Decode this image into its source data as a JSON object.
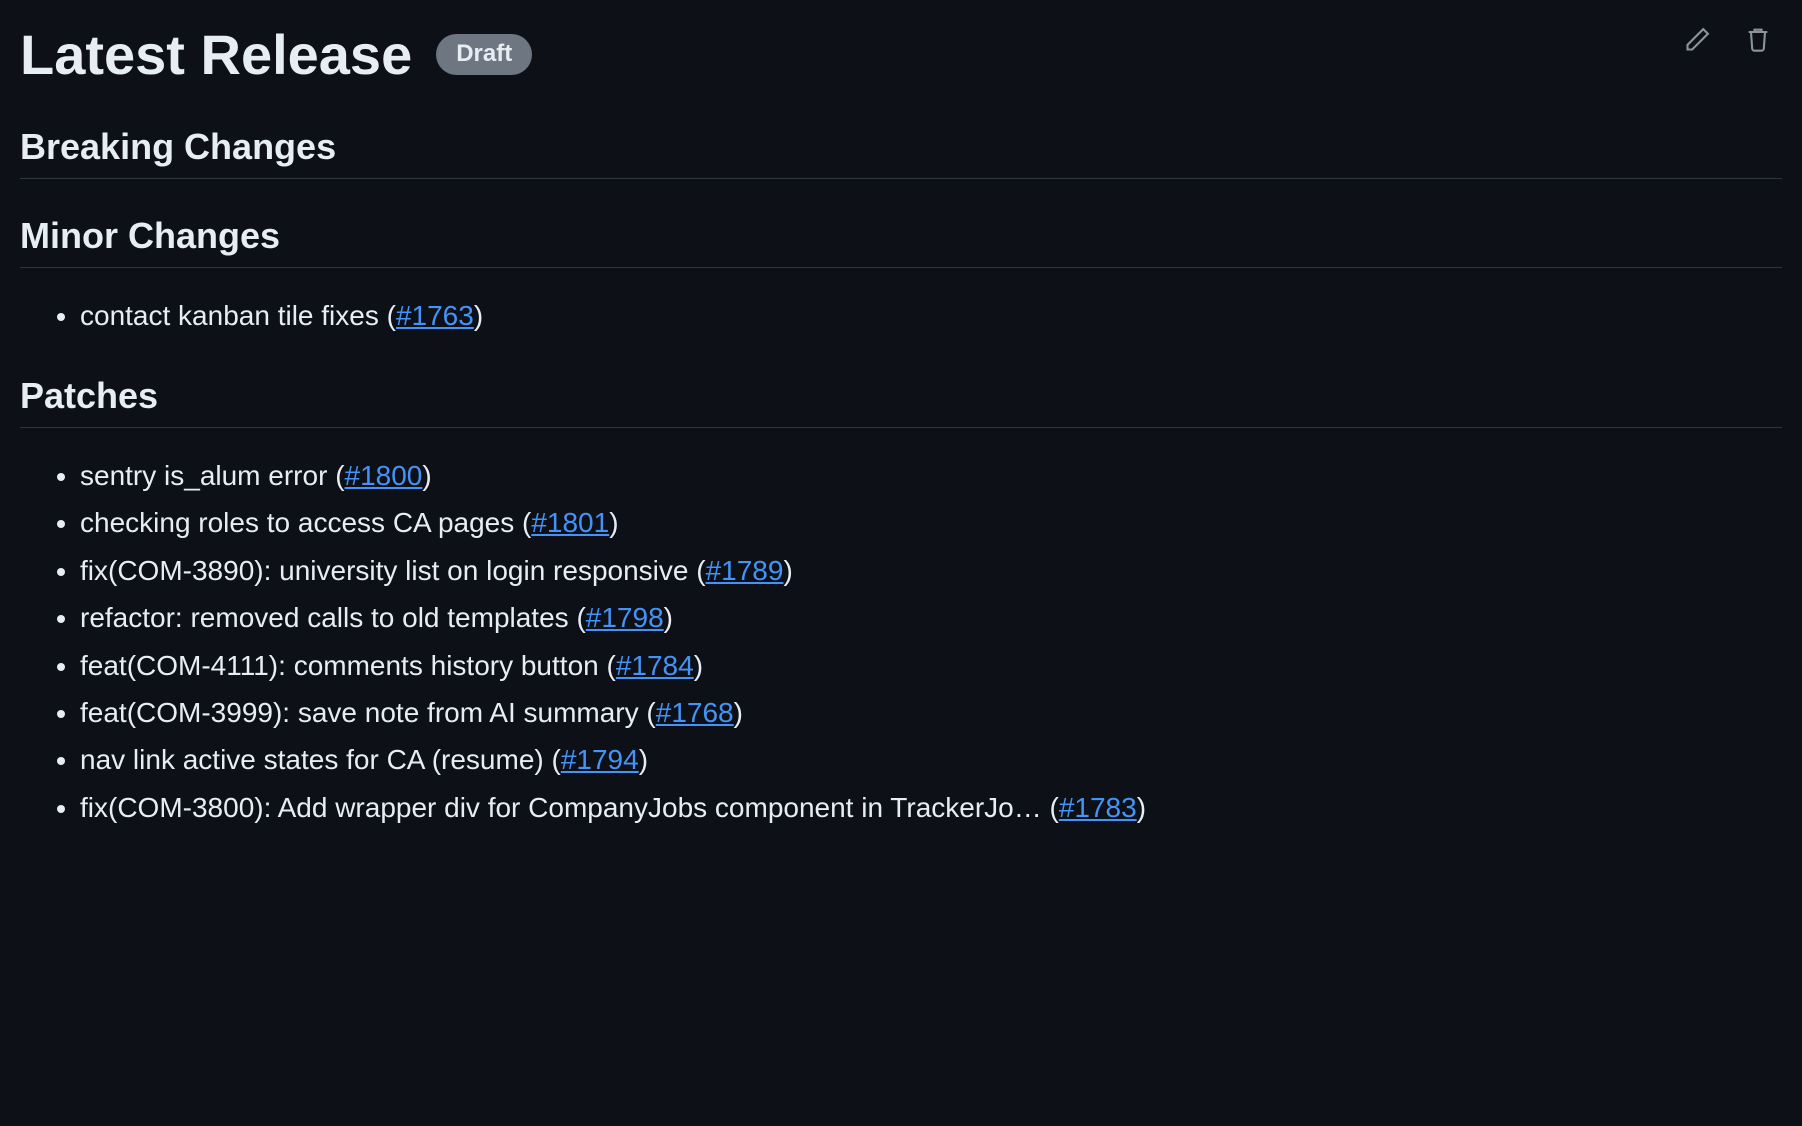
{
  "header": {
    "title": "Latest Release",
    "badge": "Draft",
    "edit_icon": "pencil-icon",
    "delete_icon": "trash-icon"
  },
  "sections": {
    "breaking": {
      "title": "Breaking Changes",
      "items": []
    },
    "minor": {
      "title": "Minor Changes",
      "items": [
        {
          "text": "contact kanban tile fixes",
          "link_label": "#1763"
        }
      ]
    },
    "patches": {
      "title": "Patches",
      "items": [
        {
          "text": "sentry is_alum error",
          "link_label": "#1800"
        },
        {
          "text": "checking roles to access CA pages",
          "link_label": "#1801"
        },
        {
          "text": "fix(COM-3890): university list on login responsive",
          "link_label": "#1789"
        },
        {
          "text": "refactor: removed calls to old templates",
          "link_label": "#1798"
        },
        {
          "text": "feat(COM-4111): comments history button",
          "link_label": "#1784"
        },
        {
          "text": "feat(COM-3999): save note from AI summary",
          "link_label": "#1768"
        },
        {
          "text": "nav link active states for CA (resume)",
          "link_label": "#1794"
        },
        {
          "text": "fix(COM-3800): Add wrapper div for CompanyJobs component in TrackerJo…",
          "link_label": "#1783"
        }
      ]
    }
  }
}
